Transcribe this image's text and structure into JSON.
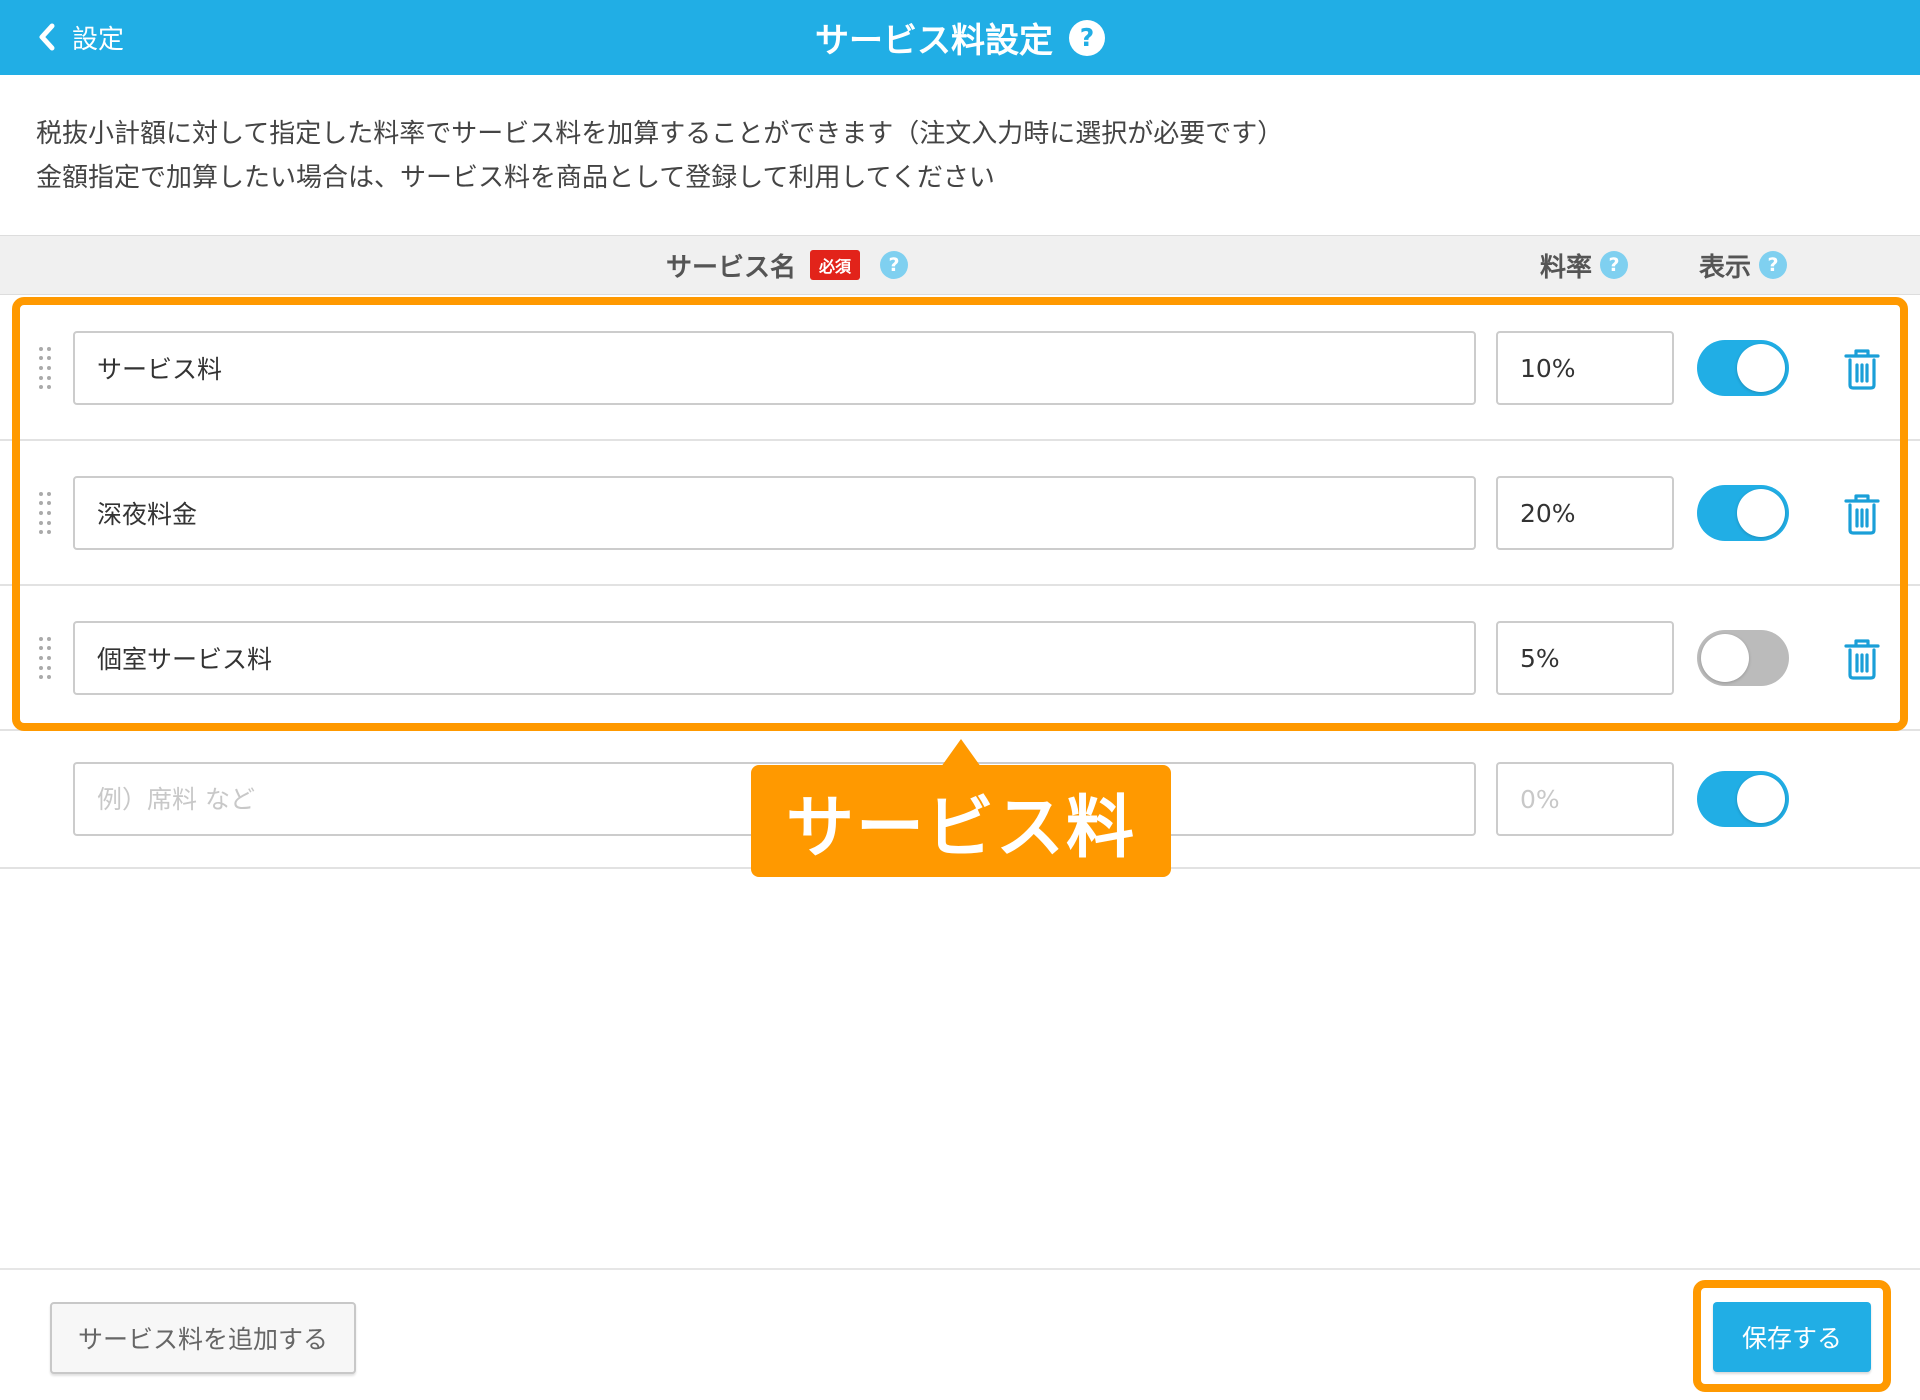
{
  "header": {
    "back_label": "設定",
    "title": "サービス料設定",
    "help_glyph": "?",
    "background_color": "#21aee5"
  },
  "description": {
    "line1": "税抜小計額に対して指定した料率でサービス料を加算することができます（注文入力時に選択が必要です）",
    "line2": "金額指定で加算したい場合は、サービス料を商品として登録して利用してください"
  },
  "columns": {
    "name": "サービス名",
    "required_badge": "必須",
    "rate": "料率",
    "display": "表示",
    "help_glyph": "?"
  },
  "rows": [
    {
      "name": "サービス料",
      "rate": "10%",
      "display": true
    },
    {
      "name": "深夜料金",
      "rate": "20%",
      "display": true
    },
    {
      "name": "個室サービス料",
      "rate": "5%",
      "display": false
    }
  ],
  "new_row": {
    "name_placeholder": "例）席料 など",
    "rate_placeholder": "0%",
    "display": true
  },
  "annotation": {
    "callout_label": "サービス料",
    "highlight_color": "#ff9900"
  },
  "footer": {
    "add_button_label": "サービス料を追加する",
    "save_button_label": "保存する"
  },
  "icons": {
    "back": "chevron-left-icon",
    "drag": "drag-handle-icon",
    "delete": "trash-icon",
    "help": "question-circle-icon"
  }
}
